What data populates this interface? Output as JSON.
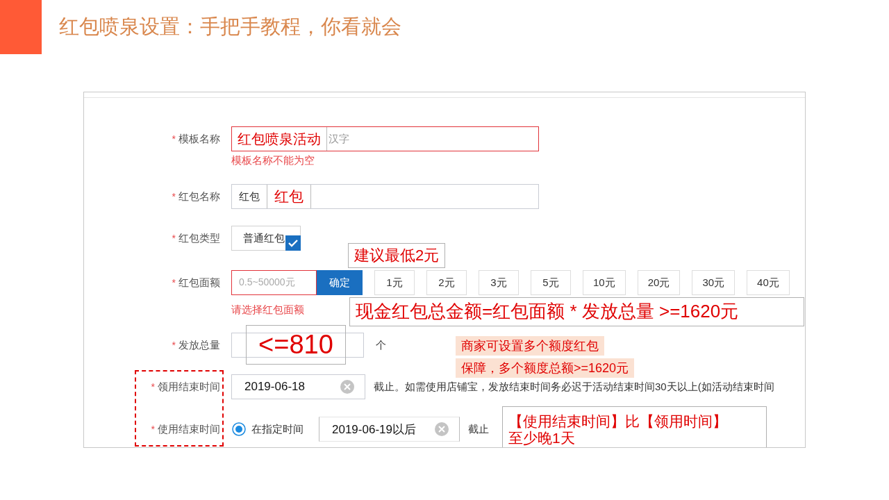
{
  "slide": {
    "title": "红包喷泉设置：手把手教程，你看就会"
  },
  "form": {
    "rows": [
      {
        "kind": "template_name",
        "label": "模板名称",
        "required_mark": "*",
        "invalid": true,
        "value": "红包喷泉活动",
        "placeholder": "汉字",
        "error": "模板名称不能为空"
      },
      {
        "kind": "name",
        "label": "红包名称",
        "required_mark": "*",
        "prefix": "红包",
        "value": "红包"
      },
      {
        "kind": "type",
        "label": "红包类型",
        "required_mark": "*",
        "option": {
          "label": "普通红包",
          "checked": true
        },
        "note": "建议最低2元"
      },
      {
        "kind": "amount",
        "label": "红包面额",
        "required_mark": "*",
        "invalid": true,
        "placeholder": "0.5~50000元",
        "button": "确定",
        "chips": [
          {
            "label": "1元",
            "selected": false
          },
          {
            "label": "2元",
            "selected": false
          },
          {
            "label": "3元",
            "selected": false
          },
          {
            "label": "5元",
            "selected": false
          },
          {
            "label": "10元",
            "selected": false
          },
          {
            "label": "20元",
            "selected": false
          },
          {
            "label": "30元",
            "selected": false
          },
          {
            "label": "40元",
            "selected": false
          }
        ],
        "error": "请选择红包面额",
        "note": "现金红包总金额=红包面额 * 发放总量 >=1620元"
      },
      {
        "kind": "quantity",
        "label": "发放总量",
        "required_mark": "*",
        "value": "<=810",
        "unit": "个",
        "notes": [
          "商家可设置多个额度红包",
          "保障，多个额度总额>=1620元"
        ]
      },
      {
        "kind": "date",
        "label": "领用结束时间",
        "required_mark": "*",
        "highlighted": true,
        "value": "2019-06-18",
        "hint": "截止。如需使用店铺宝，发放结束时间务必迟于活动结束时间30天以上(如活动结束时间"
      },
      {
        "kind": "use_date",
        "label": "使用结束时间",
        "required_mark": "*",
        "highlighted": true,
        "radio": {
          "label": "在指定时间",
          "selected": true
        },
        "value": "2019-06-19以后",
        "suffix": "截止",
        "note": [
          "【使用结束时间】比【领用时间】",
          "至少晚1天"
        ]
      }
    ]
  }
}
